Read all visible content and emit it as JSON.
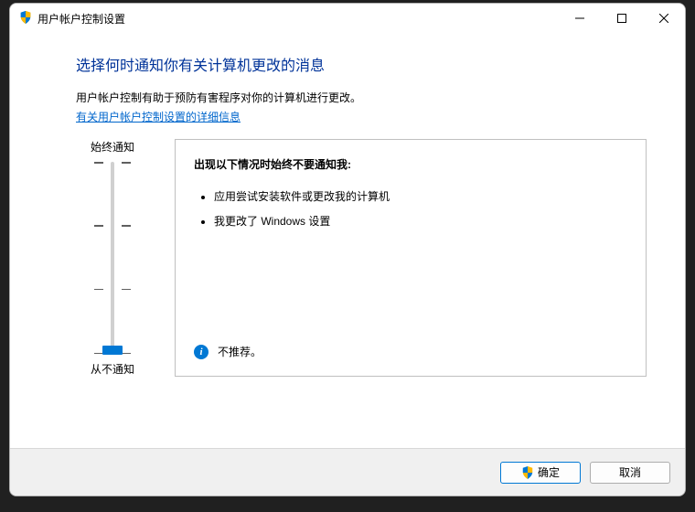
{
  "window": {
    "title": "用户帐户控制设置"
  },
  "content": {
    "heading": "选择何时通知你有关计算机更改的消息",
    "description": "用户帐户控制有助于预防有害程序对你的计算机进行更改。",
    "link": "有关用户帐户控制设置的详细信息"
  },
  "slider": {
    "top_label": "始终通知",
    "bottom_label": "从不通知",
    "levels": 4,
    "current_level": 0
  },
  "panel": {
    "title": "出现以下情况时始终不要通知我:",
    "items": [
      "应用尝试安装软件或更改我的计算机",
      "我更改了 Windows 设置"
    ],
    "note": "不推荐。"
  },
  "buttons": {
    "ok": "确定",
    "cancel": "取消"
  }
}
